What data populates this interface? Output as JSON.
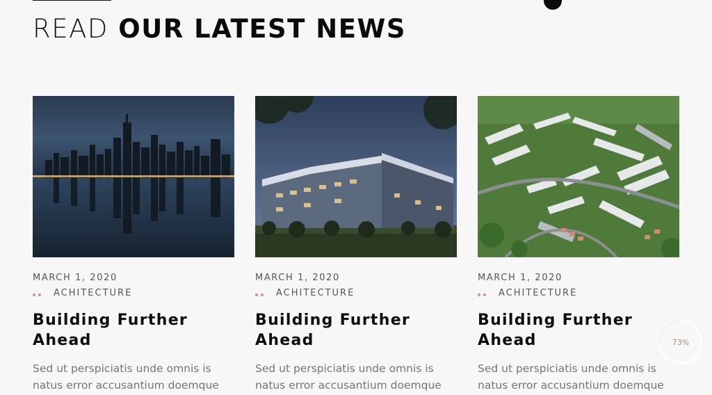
{
  "section": {
    "heading_light": "READ",
    "heading_bold": "OUR LATEST NEWS"
  },
  "posts": [
    {
      "date": "MARCH 1, 2020",
      "category": "ACHITECTURE",
      "title_line1": "Building Further",
      "title_line2": "Ahead",
      "excerpt": "Sed ut perspiciatis unde omnis is natus error accusantium doemque",
      "image": "city-skyline-night-reflection"
    },
    {
      "date": "MARCH 1, 2020",
      "category": "ACHITECTURE",
      "title_line1": "Building Further",
      "title_line2": "Ahead",
      "excerpt": "Sed ut perspiciatis unde omnis is natus error accusantium doemque",
      "image": "modern-office-building-dusk"
    },
    {
      "date": "MARCH 1, 2020",
      "category": "ACHITECTURE",
      "title_line1": "Building Further",
      "title_line2": "Ahead",
      "excerpt": "Sed ut perspiciatis unde omnis is natus error accusantium doemque",
      "image": "aerial-housing-development"
    }
  ],
  "scroll_progress": {
    "label": "73%",
    "value": 0.73
  },
  "colors": {
    "accent": "#c9977a",
    "background": "#f7f7f8",
    "text": "#0e0e0e",
    "muted": "#757575"
  }
}
